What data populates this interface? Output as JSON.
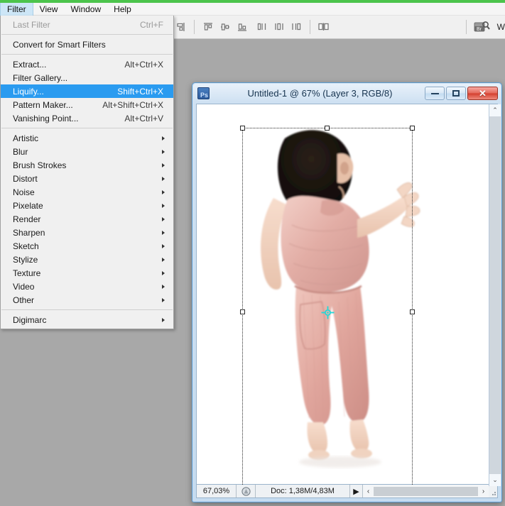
{
  "accent": {
    "top_bar_color": "#4cc44c",
    "menu_highlight": "#2a9bf0",
    "menubar_active": "#cde6f7"
  },
  "menubar": {
    "items": [
      {
        "label": "Filter",
        "active": true
      },
      {
        "label": "View",
        "active": false
      },
      {
        "label": "Window",
        "active": false
      },
      {
        "label": "Help",
        "active": false
      }
    ]
  },
  "options_bar": {
    "icons": [
      "align-left-edges-icon",
      "align-horizontal-centers-icon",
      "align-right-edges-icon",
      "align-top-edges-icon",
      "align-vertical-centers-icon",
      "align-bottom-edges-icon",
      "distribute-left-icon",
      "distribute-center-icon",
      "distribute-right-icon",
      "distribute-spacing-icon"
    ],
    "bridge_label": "Br",
    "trailing_text": "W"
  },
  "filter_menu": {
    "groups": [
      [
        {
          "label": "Last Filter",
          "accel": "Ctrl+F",
          "disabled": true,
          "submenu": false,
          "selected": false
        }
      ],
      [
        {
          "label": "Convert for Smart Filters",
          "accel": "",
          "disabled": false,
          "submenu": false,
          "selected": false
        }
      ],
      [
        {
          "label": "Extract...",
          "accel": "Alt+Ctrl+X",
          "disabled": false,
          "submenu": false,
          "selected": false
        },
        {
          "label": "Filter Gallery...",
          "accel": "",
          "disabled": false,
          "submenu": false,
          "selected": false
        },
        {
          "label": "Liquify...",
          "accel": "Shift+Ctrl+X",
          "disabled": false,
          "submenu": false,
          "selected": true
        },
        {
          "label": "Pattern Maker...",
          "accel": "Alt+Shift+Ctrl+X",
          "disabled": false,
          "submenu": false,
          "selected": false
        },
        {
          "label": "Vanishing Point...",
          "accel": "Alt+Ctrl+V",
          "disabled": false,
          "submenu": false,
          "selected": false
        }
      ],
      [
        {
          "label": "Artistic",
          "accel": "",
          "disabled": false,
          "submenu": true,
          "selected": false
        },
        {
          "label": "Blur",
          "accel": "",
          "disabled": false,
          "submenu": true,
          "selected": false
        },
        {
          "label": "Brush Strokes",
          "accel": "",
          "disabled": false,
          "submenu": true,
          "selected": false
        },
        {
          "label": "Distort",
          "accel": "",
          "disabled": false,
          "submenu": true,
          "selected": false
        },
        {
          "label": "Noise",
          "accel": "",
          "disabled": false,
          "submenu": true,
          "selected": false
        },
        {
          "label": "Pixelate",
          "accel": "",
          "disabled": false,
          "submenu": true,
          "selected": false
        },
        {
          "label": "Render",
          "accel": "",
          "disabled": false,
          "submenu": true,
          "selected": false
        },
        {
          "label": "Sharpen",
          "accel": "",
          "disabled": false,
          "submenu": true,
          "selected": false
        },
        {
          "label": "Sketch",
          "accel": "",
          "disabled": false,
          "submenu": true,
          "selected": false
        },
        {
          "label": "Stylize",
          "accel": "",
          "disabled": false,
          "submenu": true,
          "selected": false
        },
        {
          "label": "Texture",
          "accel": "",
          "disabled": false,
          "submenu": true,
          "selected": false
        },
        {
          "label": "Video",
          "accel": "",
          "disabled": false,
          "submenu": true,
          "selected": false
        },
        {
          "label": "Other",
          "accel": "",
          "disabled": false,
          "submenu": true,
          "selected": false
        }
      ],
      [
        {
          "label": "Digimarc",
          "accel": "",
          "disabled": false,
          "submenu": true,
          "selected": false
        }
      ]
    ]
  },
  "document_window": {
    "app_icon_label": "Ps",
    "title": "Untitled-1 @ 67% (Layer 3, RGB/8)",
    "buttons": {
      "minimize": "Minimize",
      "maximize": "Maximize",
      "close": "✕"
    },
    "canvas": {
      "description": "Toddler in pink knit outfit on white background with free-transform bounding box",
      "transform_active": true,
      "reference_point": "center"
    },
    "scrollbars": {
      "vertical_up": "⌃",
      "vertical_down": "⌄",
      "horizontal_left": "‹",
      "horizontal_right": "›"
    },
    "status_bar": {
      "zoom": "67,03%",
      "doc_info": "Doc: 1,38M/4,83M",
      "expand_arrow": "▶"
    }
  }
}
